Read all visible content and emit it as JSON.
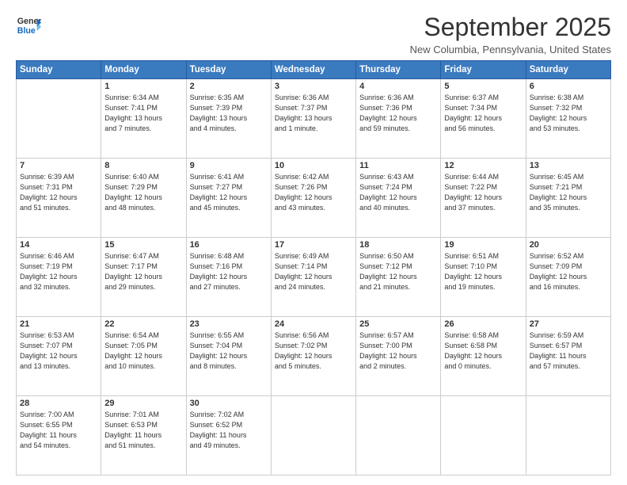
{
  "logo": {
    "line1": "General",
    "line2": "Blue"
  },
  "title": "September 2025",
  "subtitle": "New Columbia, Pennsylvania, United States",
  "header_row": [
    "Sunday",
    "Monday",
    "Tuesday",
    "Wednesday",
    "Thursday",
    "Friday",
    "Saturday"
  ],
  "weeks": [
    [
      {
        "day": "",
        "lines": []
      },
      {
        "day": "1",
        "lines": [
          "Sunrise: 6:34 AM",
          "Sunset: 7:41 PM",
          "Daylight: 13 hours",
          "and 7 minutes."
        ]
      },
      {
        "day": "2",
        "lines": [
          "Sunrise: 6:35 AM",
          "Sunset: 7:39 PM",
          "Daylight: 13 hours",
          "and 4 minutes."
        ]
      },
      {
        "day": "3",
        "lines": [
          "Sunrise: 6:36 AM",
          "Sunset: 7:37 PM",
          "Daylight: 13 hours",
          "and 1 minute."
        ]
      },
      {
        "day": "4",
        "lines": [
          "Sunrise: 6:36 AM",
          "Sunset: 7:36 PM",
          "Daylight: 12 hours",
          "and 59 minutes."
        ]
      },
      {
        "day": "5",
        "lines": [
          "Sunrise: 6:37 AM",
          "Sunset: 7:34 PM",
          "Daylight: 12 hours",
          "and 56 minutes."
        ]
      },
      {
        "day": "6",
        "lines": [
          "Sunrise: 6:38 AM",
          "Sunset: 7:32 PM",
          "Daylight: 12 hours",
          "and 53 minutes."
        ]
      }
    ],
    [
      {
        "day": "7",
        "lines": [
          "Sunrise: 6:39 AM",
          "Sunset: 7:31 PM",
          "Daylight: 12 hours",
          "and 51 minutes."
        ]
      },
      {
        "day": "8",
        "lines": [
          "Sunrise: 6:40 AM",
          "Sunset: 7:29 PM",
          "Daylight: 12 hours",
          "and 48 minutes."
        ]
      },
      {
        "day": "9",
        "lines": [
          "Sunrise: 6:41 AM",
          "Sunset: 7:27 PM",
          "Daylight: 12 hours",
          "and 45 minutes."
        ]
      },
      {
        "day": "10",
        "lines": [
          "Sunrise: 6:42 AM",
          "Sunset: 7:26 PM",
          "Daylight: 12 hours",
          "and 43 minutes."
        ]
      },
      {
        "day": "11",
        "lines": [
          "Sunrise: 6:43 AM",
          "Sunset: 7:24 PM",
          "Daylight: 12 hours",
          "and 40 minutes."
        ]
      },
      {
        "day": "12",
        "lines": [
          "Sunrise: 6:44 AM",
          "Sunset: 7:22 PM",
          "Daylight: 12 hours",
          "and 37 minutes."
        ]
      },
      {
        "day": "13",
        "lines": [
          "Sunrise: 6:45 AM",
          "Sunset: 7:21 PM",
          "Daylight: 12 hours",
          "and 35 minutes."
        ]
      }
    ],
    [
      {
        "day": "14",
        "lines": [
          "Sunrise: 6:46 AM",
          "Sunset: 7:19 PM",
          "Daylight: 12 hours",
          "and 32 minutes."
        ]
      },
      {
        "day": "15",
        "lines": [
          "Sunrise: 6:47 AM",
          "Sunset: 7:17 PM",
          "Daylight: 12 hours",
          "and 29 minutes."
        ]
      },
      {
        "day": "16",
        "lines": [
          "Sunrise: 6:48 AM",
          "Sunset: 7:16 PM",
          "Daylight: 12 hours",
          "and 27 minutes."
        ]
      },
      {
        "day": "17",
        "lines": [
          "Sunrise: 6:49 AM",
          "Sunset: 7:14 PM",
          "Daylight: 12 hours",
          "and 24 minutes."
        ]
      },
      {
        "day": "18",
        "lines": [
          "Sunrise: 6:50 AM",
          "Sunset: 7:12 PM",
          "Daylight: 12 hours",
          "and 21 minutes."
        ]
      },
      {
        "day": "19",
        "lines": [
          "Sunrise: 6:51 AM",
          "Sunset: 7:10 PM",
          "Daylight: 12 hours",
          "and 19 minutes."
        ]
      },
      {
        "day": "20",
        "lines": [
          "Sunrise: 6:52 AM",
          "Sunset: 7:09 PM",
          "Daylight: 12 hours",
          "and 16 minutes."
        ]
      }
    ],
    [
      {
        "day": "21",
        "lines": [
          "Sunrise: 6:53 AM",
          "Sunset: 7:07 PM",
          "Daylight: 12 hours",
          "and 13 minutes."
        ]
      },
      {
        "day": "22",
        "lines": [
          "Sunrise: 6:54 AM",
          "Sunset: 7:05 PM",
          "Daylight: 12 hours",
          "and 10 minutes."
        ]
      },
      {
        "day": "23",
        "lines": [
          "Sunrise: 6:55 AM",
          "Sunset: 7:04 PM",
          "Daylight: 12 hours",
          "and 8 minutes."
        ]
      },
      {
        "day": "24",
        "lines": [
          "Sunrise: 6:56 AM",
          "Sunset: 7:02 PM",
          "Daylight: 12 hours",
          "and 5 minutes."
        ]
      },
      {
        "day": "25",
        "lines": [
          "Sunrise: 6:57 AM",
          "Sunset: 7:00 PM",
          "Daylight: 12 hours",
          "and 2 minutes."
        ]
      },
      {
        "day": "26",
        "lines": [
          "Sunrise: 6:58 AM",
          "Sunset: 6:58 PM",
          "Daylight: 12 hours",
          "and 0 minutes."
        ]
      },
      {
        "day": "27",
        "lines": [
          "Sunrise: 6:59 AM",
          "Sunset: 6:57 PM",
          "Daylight: 11 hours",
          "and 57 minutes."
        ]
      }
    ],
    [
      {
        "day": "28",
        "lines": [
          "Sunrise: 7:00 AM",
          "Sunset: 6:55 PM",
          "Daylight: 11 hours",
          "and 54 minutes."
        ]
      },
      {
        "day": "29",
        "lines": [
          "Sunrise: 7:01 AM",
          "Sunset: 6:53 PM",
          "Daylight: 11 hours",
          "and 51 minutes."
        ]
      },
      {
        "day": "30",
        "lines": [
          "Sunrise: 7:02 AM",
          "Sunset: 6:52 PM",
          "Daylight: 11 hours",
          "and 49 minutes."
        ]
      },
      {
        "day": "",
        "lines": []
      },
      {
        "day": "",
        "lines": []
      },
      {
        "day": "",
        "lines": []
      },
      {
        "day": "",
        "lines": []
      }
    ]
  ]
}
